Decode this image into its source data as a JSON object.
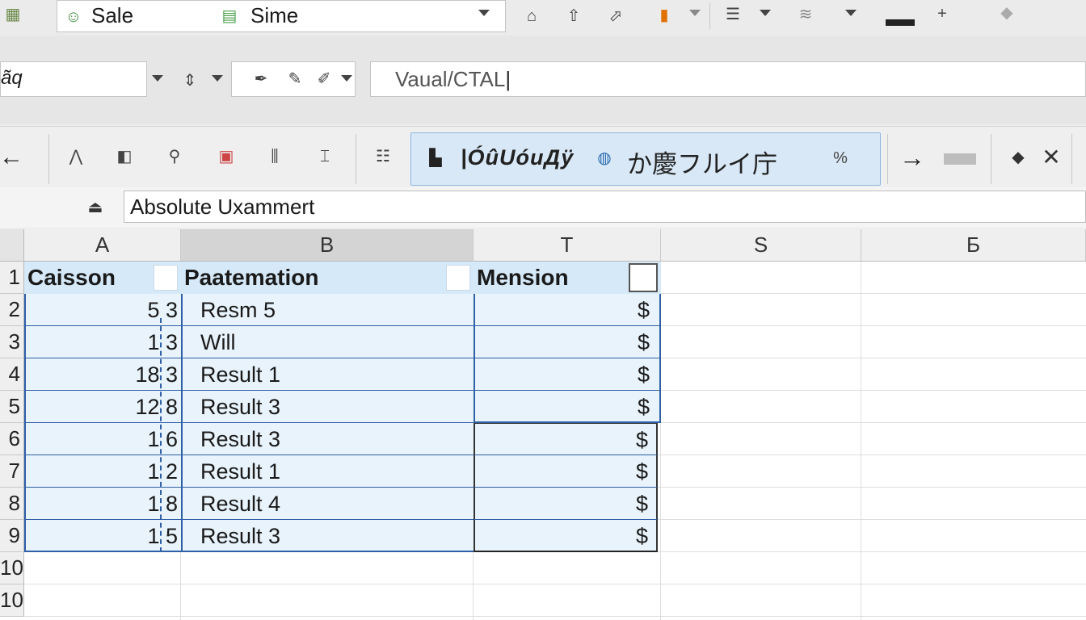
{
  "toolbar": {
    "name_box_1": "Sale",
    "name_box_2": "Sime",
    "value_field": "Vaual/CTAL",
    "cell_ref_partial": "ãq"
  },
  "ribbon": {
    "group_text": "|ÓûUóиДÿ",
    "group_text_2": "か慶フルイ庁"
  },
  "formula_bar": {
    "content": "Absolute Uxammert"
  },
  "columns": [
    "A",
    "B",
    "T",
    "S",
    "Б"
  ],
  "rows": [
    "1",
    "2",
    "3",
    "4",
    "5",
    "6",
    "7",
    "8",
    "9",
    "10",
    "10"
  ],
  "headers": {
    "a": "Caisson",
    "b": "Paatemation",
    "t": "Mension"
  },
  "table": [
    {
      "a": "5 3",
      "b": "Resm 5",
      "t": "$"
    },
    {
      "a": "1 3",
      "b": "Will",
      "t": "$"
    },
    {
      "a": "18 3",
      "b": "Result 1",
      "t": "$"
    },
    {
      "a": "12 8",
      "b": "Result 3",
      "t": "$"
    },
    {
      "a": "1 6",
      "b": "Result 3",
      "t": "$"
    },
    {
      "a": "1 2",
      "b": "Result 1",
      "t": "$"
    },
    {
      "a": "1 8",
      "b": "Result 4",
      "t": "$"
    },
    {
      "a": "1 5",
      "b": "Result 3",
      "t": "$"
    }
  ],
  "colors": {
    "accent_blue": "#2f5fa7",
    "selection_fill": "#e8f3fb",
    "header_fill": "#d6e9f8"
  }
}
